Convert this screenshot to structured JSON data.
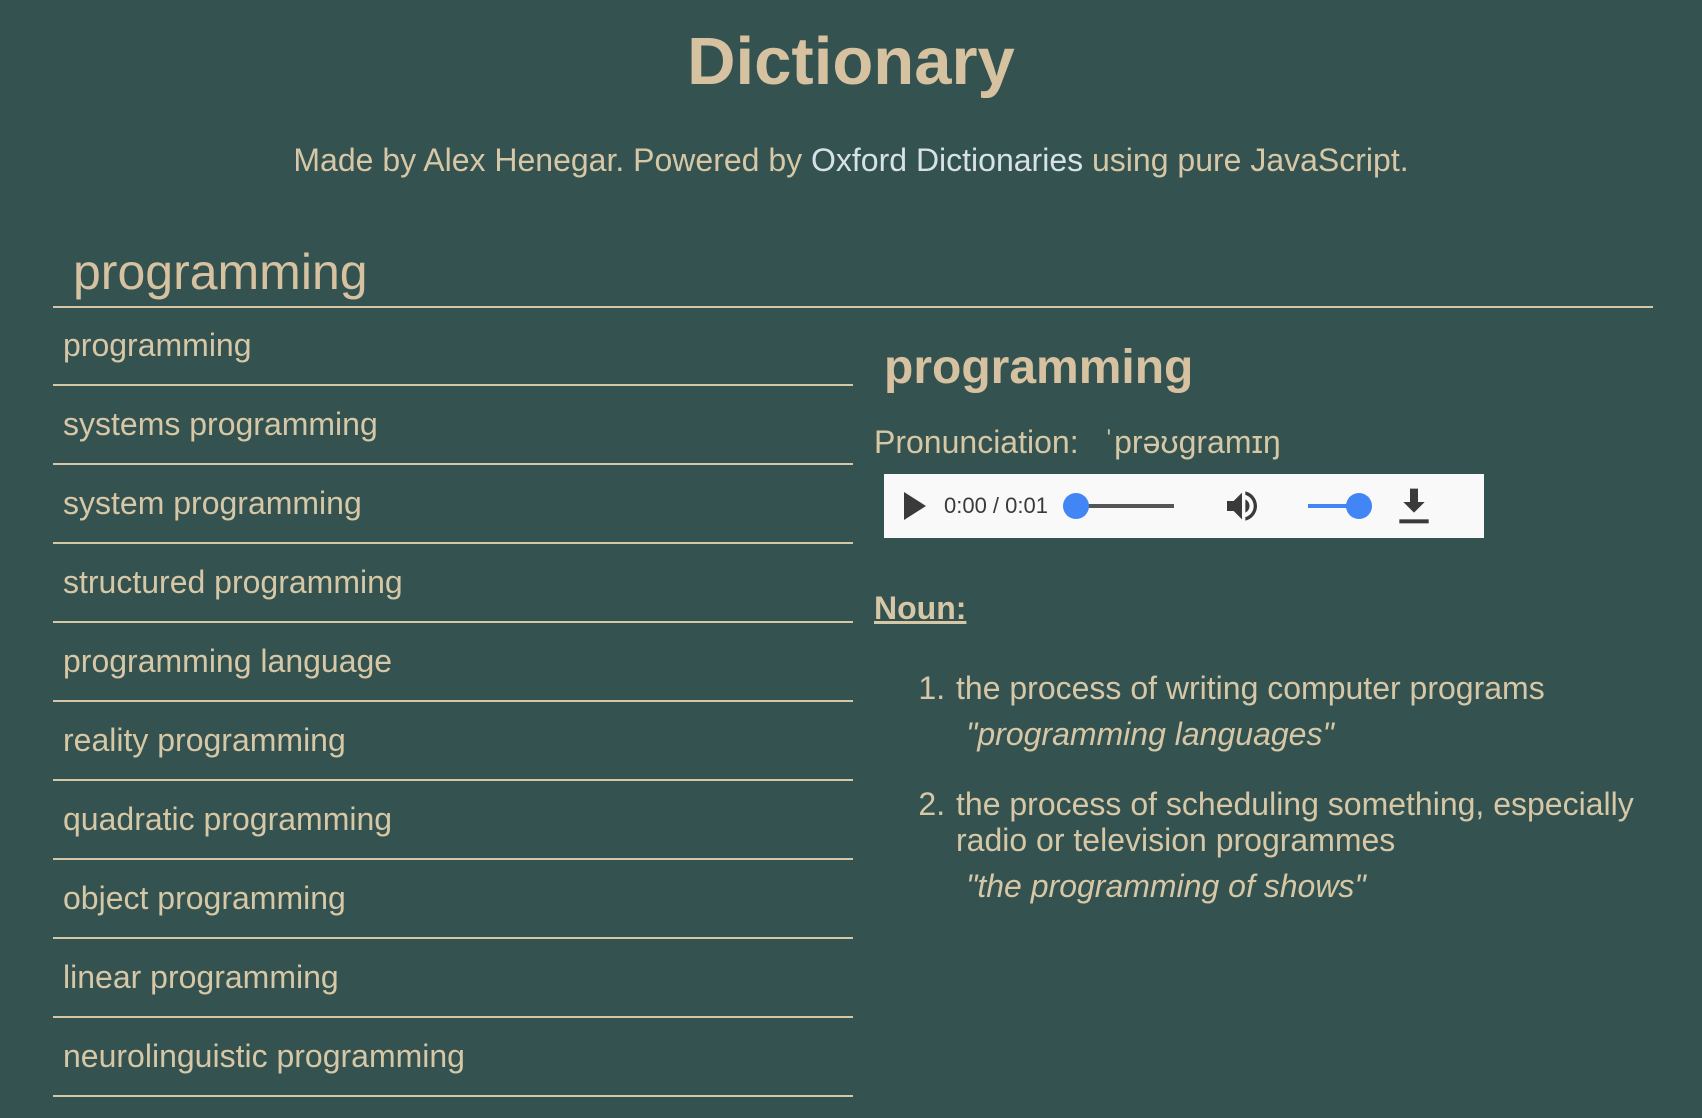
{
  "header": {
    "title": "Dictionary",
    "subtitle_prefix": "Made by Alex Henegar. Powered by ",
    "subtitle_link": "Oxford Dictionaries",
    "subtitle_suffix": " using pure JavaScript."
  },
  "search": {
    "value": "programming"
  },
  "results": [
    "programming",
    "systems programming",
    "system programming",
    "structured programming",
    "programming language",
    "reality programming",
    "quadratic programming",
    "object programming",
    "linear programming",
    "neurolinguistic programming"
  ],
  "entry": {
    "word": "programming",
    "pronunciation_label": "Pronunciation:",
    "ipa": "ˈprəʊɡramɪŋ",
    "audio": {
      "time": "0:00 / 0:01",
      "progress": 0,
      "volume": 1
    },
    "part_of_speech": "Noun:",
    "definitions": [
      {
        "text": "the process of writing computer programs",
        "example": "\"programming languages\""
      },
      {
        "text": "the process of scheduling something, especially radio or television programmes",
        "example": "\"the programming of shows\""
      }
    ]
  },
  "icons": {
    "play": "play-icon",
    "volume": "volume-icon",
    "download": "download-icon"
  },
  "colors": {
    "background": "#34524f",
    "text": "#d6c7a6",
    "link": "#d6e2e8",
    "accent": "#4285f4"
  }
}
